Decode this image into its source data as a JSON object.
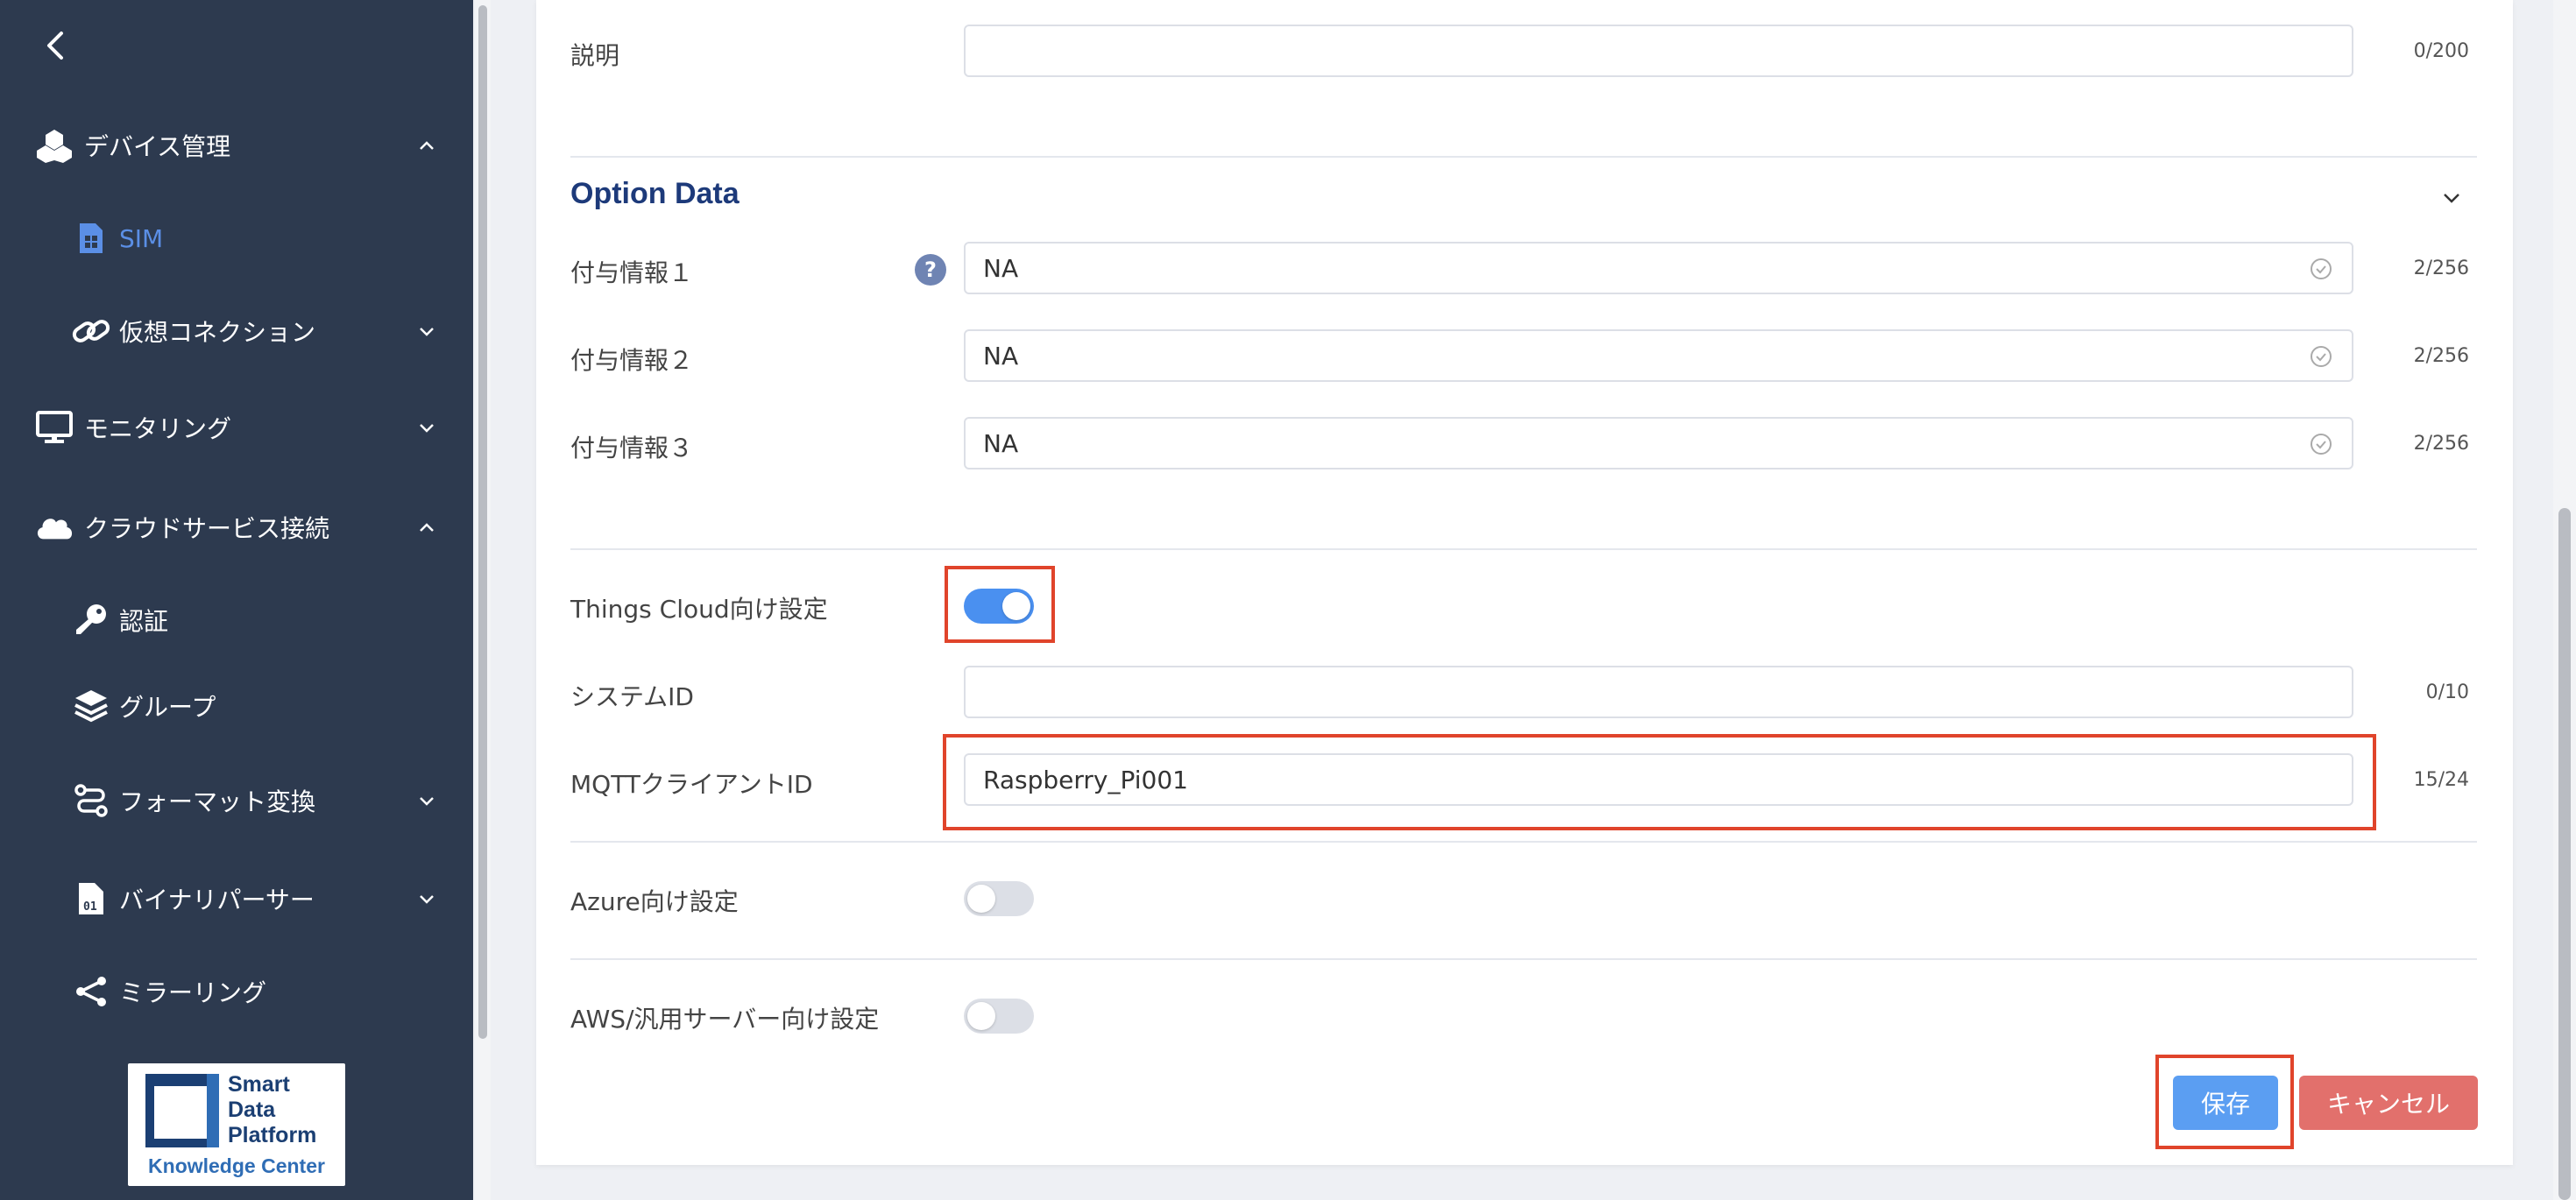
{
  "sidebar": {
    "items": [
      {
        "label": "デバイス管理",
        "icon": "devices-icon",
        "chevron": "chevron-up-icon"
      },
      {
        "label": "SIM",
        "icon": "sim-card-icon"
      },
      {
        "label": "仮想コネクション",
        "icon": "link-icon",
        "chevron": "chevron-down-icon"
      },
      {
        "label": "モニタリング",
        "icon": "monitor-icon",
        "chevron": "chevron-down-icon"
      },
      {
        "label": "クラウドサービス接続",
        "icon": "cloud-icon",
        "chevron": "chevron-up-icon"
      },
      {
        "label": "認証",
        "icon": "key-icon"
      },
      {
        "label": "グループ",
        "icon": "layers-icon"
      },
      {
        "label": "フォーマット変換",
        "icon": "route-icon",
        "chevron": "chevron-down-icon"
      },
      {
        "label": "バイナリパーサー",
        "icon": "binary-file-icon",
        "chevron": "chevron-down-icon"
      },
      {
        "label": "ミラーリング",
        "icon": "share-icon"
      }
    ],
    "logo": {
      "line1": "Smart",
      "line2": "Data",
      "line3": "Platform",
      "sub": "Knowledge Center"
    }
  },
  "form": {
    "description": {
      "label": "説明",
      "value": "",
      "counter": "0/200"
    },
    "option_section": {
      "title": "Option Data"
    },
    "options": [
      {
        "label": "付与情報１",
        "value": "NA",
        "counter": "2/256"
      },
      {
        "label": "付与情報２",
        "value": "NA",
        "counter": "2/256"
      },
      {
        "label": "付与情報３",
        "value": "NA",
        "counter": "2/256"
      }
    ],
    "things_cloud": {
      "label": "Things Cloud向け設定",
      "enabled": true
    },
    "system_id": {
      "label": "システムID",
      "value": "",
      "counter": "0/10"
    },
    "mqtt_client_id": {
      "label": "MQTTクライアントID",
      "value": "Raspberry_Pi001",
      "counter": "15/24"
    },
    "azure": {
      "label": "Azure向け設定",
      "enabled": false
    },
    "aws": {
      "label": "AWS/汎用サーバー向け設定",
      "enabled": false
    },
    "help_icon_text": "?"
  },
  "actions": {
    "save_label": "保存",
    "cancel_label": "キャンセル"
  },
  "colors": {
    "sidebar_bg": "#2d3a4f",
    "accent": "#4a90f0",
    "save": "#5b9ef2",
    "cancel": "#e2706c",
    "highlight": "#e0442b",
    "section_title": "#1d3a7a"
  }
}
